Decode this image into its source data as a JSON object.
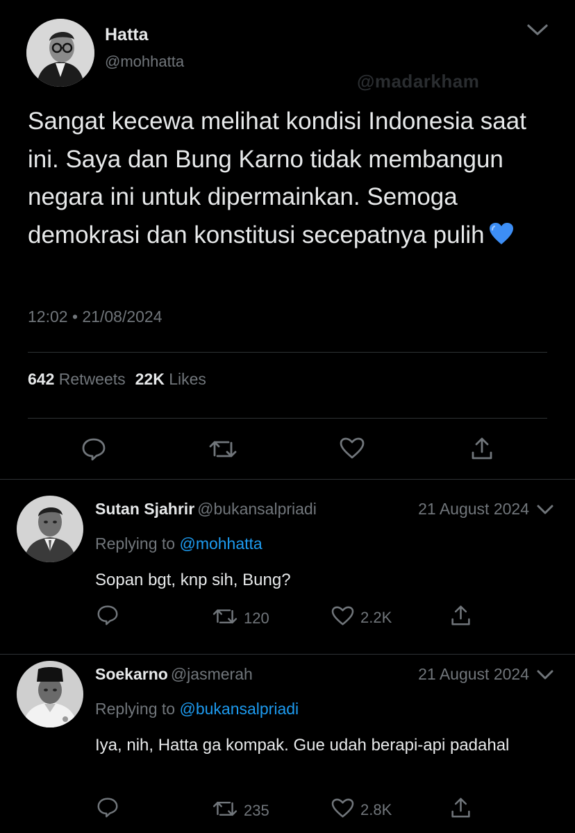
{
  "main_tweet": {
    "author_name": "Hatta",
    "author_handle": "@mohhatta",
    "watermark": "@madarkham",
    "text": "Sangat kecewa melihat kondisi Indonesia saat ini. Saya dan Bung Karno tidak membangun negara ini untuk dipermainkan. Semoga demokrasi dan konstitusi secepatnya pulih",
    "emoji": "blue-heart",
    "timestamp": "12:02 • 21/08/2024",
    "retweets_count": "642",
    "retweets_label": "Retweets",
    "likes_count": "22K",
    "likes_label": "Likes",
    "actions": [
      "reply-icon",
      "retweet-icon",
      "like-icon",
      "share-icon"
    ]
  },
  "replies": [
    {
      "author_name": "Sutan Sjahrir",
      "author_handle": "@bukansalpriadi",
      "date": "21 August 2024",
      "replying_prefix": "Replying to",
      "replying_to": "@mohhatta",
      "text": "Sopan bgt, knp sih, Bung?",
      "retweets": "120",
      "likes": "2.2K"
    },
    {
      "author_name": "Soekarno",
      "author_handle": "@jasmerah",
      "date": "21 August 2024",
      "replying_prefix": "Replying to",
      "replying_to": "@bukansalpriadi",
      "text": "Iya, nih, Hatta ga kompak. Gue udah berapi-api padahal",
      "retweets": "235",
      "likes": "2.8K"
    }
  ],
  "colors": {
    "background": "#000000",
    "text": "#e7e9ea",
    "secondary": "#71767b",
    "link": "#1d9bf0",
    "divider": "#2f3336"
  }
}
